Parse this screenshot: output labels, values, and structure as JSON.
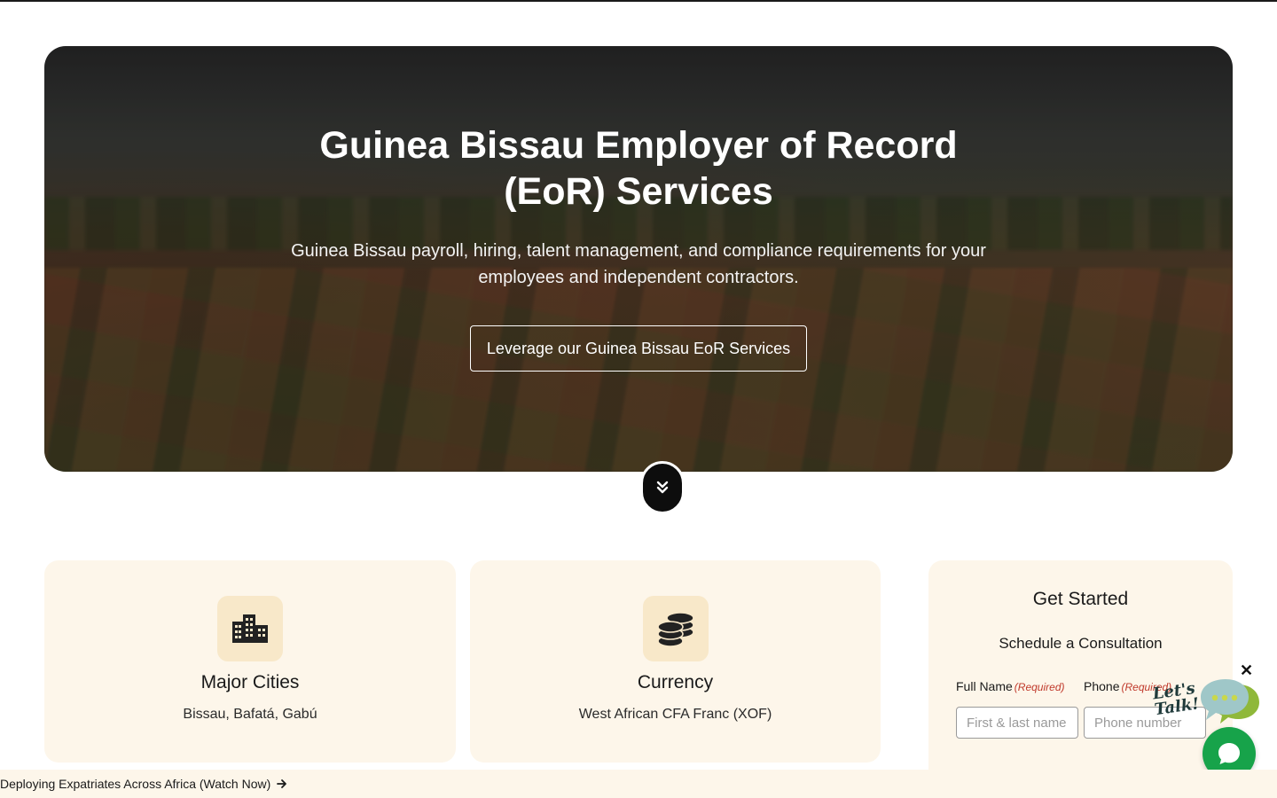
{
  "hero": {
    "title": "Guinea Bissau Employer of Record (EoR) Services",
    "subtitle": "Guinea Bissau payroll, hiring, talent management, and compliance requirements for your employees and independent contractors.",
    "cta_label": "Leverage our Guinea Bissau EoR Services"
  },
  "info_cards": [
    {
      "icon": "buildings-icon",
      "title": "Major Cities",
      "text": "Bissau, Bafatá, Gabú"
    },
    {
      "icon": "coins-icon",
      "title": "Currency",
      "text": "West African CFA Franc (XOF)"
    }
  ],
  "form": {
    "title": "Get Started",
    "subtitle": "Schedule a Consultation",
    "full_name_label": "Full Name",
    "phone_label": "Phone",
    "required_text": "(Required)",
    "full_name_placeholder": "First & last name",
    "phone_placeholder": "Phone number"
  },
  "chat": {
    "bubble_text": "Let's Talk!",
    "close_glyph": "✕"
  },
  "announcement": {
    "text": "Deploying Expatriates Across Africa (Watch Now)"
  },
  "colors": {
    "card_bg": "#fdf6ea",
    "icon_tile_bg": "#f8e8c9",
    "required": "#c0392b",
    "chat_green": "#17a34a"
  }
}
